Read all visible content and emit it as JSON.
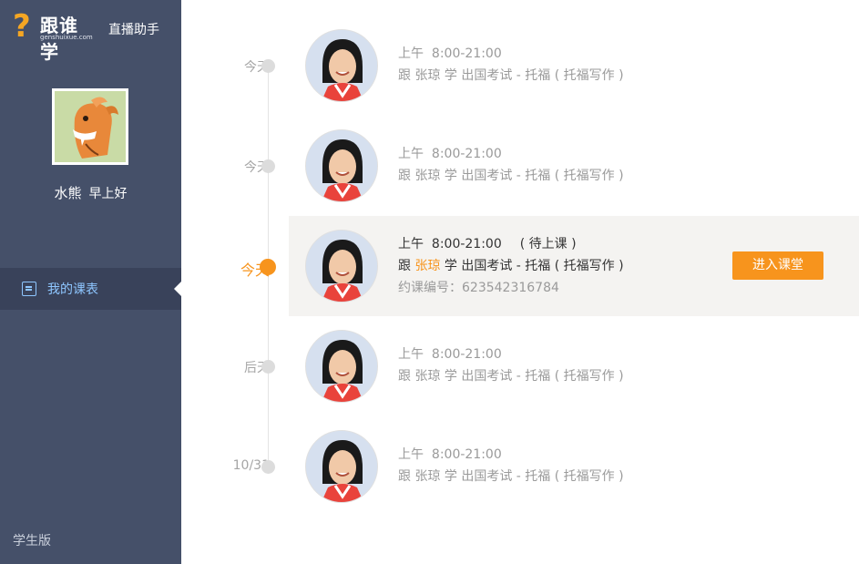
{
  "brand": {
    "logo_mark": "?",
    "logo_text": "跟谁学",
    "logo_url": "genshuixue.com",
    "app_name": "直播助手"
  },
  "user": {
    "name": "水熊",
    "greeting": "早上好"
  },
  "nav": {
    "items": [
      {
        "label": "我的课表",
        "icon": "schedule-icon"
      }
    ]
  },
  "version_label": "学生版",
  "lessons": [
    {
      "day": "今天",
      "time_prefix": "上午",
      "time": "8:00-21:00",
      "prefix": "跟",
      "teacher": "张琼",
      "suffix": "学 出国考试 - 托福 ( 托福写作 )"
    },
    {
      "day": "今天",
      "time_prefix": "上午",
      "time": "8:00-21:00",
      "prefix": "跟",
      "teacher": "张琼",
      "suffix": "学 出国考试 - 托福 ( 托福写作 )"
    },
    {
      "day": "今天",
      "time_prefix": "上午",
      "time": "8:00-21:00",
      "status": "( 待上课 )",
      "prefix": "跟",
      "teacher": "张琼",
      "suffix": "学 出国考试 - 托福 ( 托福写作 )",
      "order_label": "约课编号：",
      "order_no": "623542316784",
      "button": "进入课堂"
    },
    {
      "day": "后天",
      "time_prefix": "上午",
      "time": "8:00-21:00",
      "prefix": "跟",
      "teacher": "张琼",
      "suffix": "学 出国考试 - 托福 ( 托福写作 )"
    },
    {
      "day": "10/31",
      "time_prefix": "上午",
      "time": "8:00-21:00",
      "prefix": "跟",
      "teacher": "张琼",
      "suffix": "学 出国考试 - 托福 ( 托福写作 )"
    }
  ],
  "colors": {
    "sidebar": "#455069",
    "accent": "#f7941d",
    "nav_active_text": "#8ec6ff"
  }
}
